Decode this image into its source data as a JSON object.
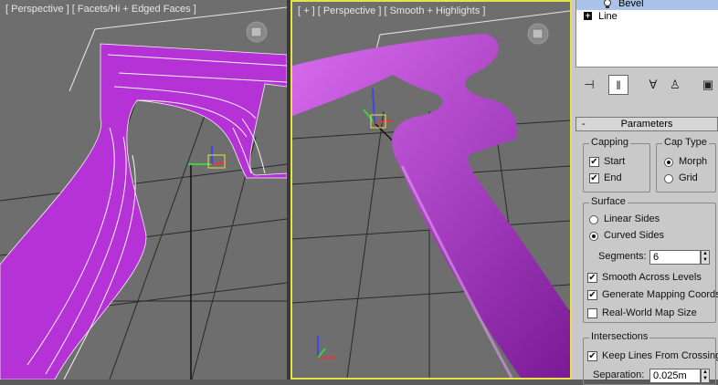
{
  "viewports": {
    "left": {
      "label": "[ Perspective ] [ Facets/Hi + Edged Faces ]"
    },
    "right": {
      "label": "[ + ] [ Perspective ] [ Smooth + Highlights ]"
    }
  },
  "modifier_stack": {
    "items": [
      {
        "label": "Bevel",
        "selected": true
      },
      {
        "label": "Line",
        "expandable": true
      }
    ]
  },
  "toolbar": {
    "icons": [
      "pin-stack-icon",
      "show-end-result-icon",
      "make-unique-icon",
      "remove-modifier-icon",
      "configure-modifier-sets-icon"
    ]
  },
  "parameters": {
    "title": "Parameters",
    "capping": {
      "title": "Capping",
      "start": "Start",
      "end": "End",
      "start_checked": true,
      "end_checked": true
    },
    "cap_type": {
      "title": "Cap Type",
      "morph": "Morph",
      "grid": "Grid",
      "selected": "Morph"
    },
    "surface": {
      "title": "Surface",
      "linear_sides": "Linear Sides",
      "curved_sides": "Curved Sides",
      "selected": "Curved Sides",
      "segments_label": "Segments:",
      "segments_value": "6",
      "smooth_across_levels": "Smooth Across Levels",
      "generate_mapping": "Generate Mapping Coords.",
      "real_world_map": "Real-World Map Size"
    },
    "intersections": {
      "title": "Intersections",
      "keep_lines": "Keep Lines From Crossing",
      "separation_label": "Separation:",
      "separation_value": "0.025m"
    }
  },
  "colors": {
    "accent_viewport_border": "#e8e24a",
    "object_color": "#b533d6",
    "grid_color": "#1a1a1a"
  }
}
